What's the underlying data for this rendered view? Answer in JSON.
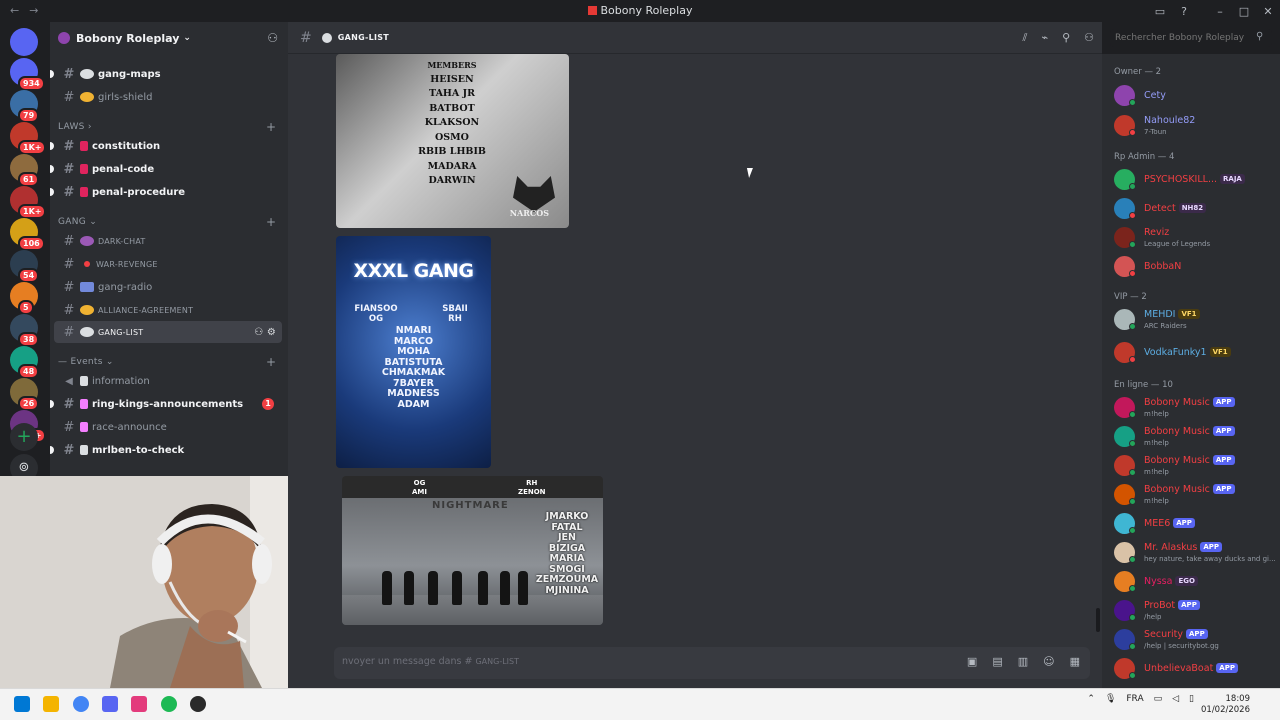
{
  "window": {
    "title": "Bobony Roleplay"
  },
  "servers": {
    "items": [
      {
        "badge": "934",
        "color": "#5865f2"
      },
      {
        "badge": "79",
        "color": "#3a6ea5"
      },
      {
        "badge": "1K+",
        "color": "#c0392b"
      },
      {
        "badge": "61",
        "color": "#8e6b3e"
      },
      {
        "badge": "1K+",
        "color": "#b03030"
      },
      {
        "badge": "106",
        "color": "#d4a017"
      },
      {
        "badge": "54",
        "color": "#2c3e50"
      },
      {
        "badge": "5",
        "color": "#e67e22"
      },
      {
        "badge": "38",
        "color": "#34495e"
      },
      {
        "badge": "48",
        "color": "#16a085"
      },
      {
        "badge": "26",
        "color": "#7f6a3a"
      },
      {
        "badge": "2K+",
        "color": "#6c3483"
      }
    ]
  },
  "guild": {
    "name": "Bobony Roleplay"
  },
  "sidebar": {
    "channels_top": [
      {
        "name": "gang-maps",
        "emoji_color": "#dbdee1",
        "unread": true
      },
      {
        "name": "girls-shield",
        "emoji_color": "#f0b232",
        "unread": false
      }
    ],
    "cat_laws": "LAWS",
    "laws": [
      {
        "name": "constitution"
      },
      {
        "name": "penal-code"
      },
      {
        "name": "penal-procedure"
      }
    ],
    "cat_gang": "GANG",
    "gang": [
      {
        "name": "DARK-CHAT"
      },
      {
        "name": "WAR-REVENGE"
      },
      {
        "name": "gang-radio"
      },
      {
        "name": "ALLIANCE-AGREEMENT"
      },
      {
        "name": "GANG-LIST"
      }
    ],
    "cat_events": "Events",
    "events": [
      {
        "name": "information"
      },
      {
        "name": "ring-kings-announcements",
        "badge": "1"
      },
      {
        "name": "race-announce"
      },
      {
        "name": "mrlben-to-check"
      }
    ]
  },
  "channel": {
    "name": "GANG-LIST"
  },
  "search": {
    "placeholder": "Rechercher Bobony Roleplay"
  },
  "messages": {
    "img1": {
      "header": "MEMBERS",
      "names": [
        "HEISEN",
        "TAHA JR",
        "BATBOT",
        "KLAKSON",
        "OSMO",
        "RBIB LHBIB",
        "MADARA",
        "DARWIN"
      ],
      "brand": "NARCOS"
    },
    "img2": {
      "title": "XXXL GANG",
      "og_name": "FIANSOO",
      "og_tag": "OG",
      "rh_name": "SBAII",
      "rh_tag": "RH",
      "names": [
        "NMARI",
        "MARCO",
        "MOHA",
        "BATISTUTA",
        "CHMAKMAK",
        "7BAYER",
        "MADNESS",
        "ADAM"
      ]
    },
    "img3": {
      "og_tag": "OG",
      "og_name": "AMI",
      "rh_tag": "RH",
      "rh_name": "ZENON",
      "band": "NIGHTMARE",
      "names": [
        "JMARKO",
        "FATAL",
        "JEN",
        "BIZIGA",
        "MARIA",
        "SMOGI",
        "ZEMZOUMA",
        "MJININA"
      ]
    }
  },
  "composer": {
    "placeholder": "nvoyer un message dans #",
    "channel": "GANG-LIST"
  },
  "members": {
    "groups": [
      {
        "label": "Owner — 2",
        "items": [
          {
            "name": "Cety",
            "color": "#949cf7",
            "av": "#8e44ad",
            "status": "online"
          },
          {
            "name": "Nahoule82",
            "color": "#949cf7",
            "av": "#c0392b",
            "status": "dnd",
            "sub": "7-Toun"
          }
        ]
      },
      {
        "label": "Rp Admin — 4",
        "items": [
          {
            "name": "PSYCHOSKILL...",
            "color": "#f23f43",
            "av": "#27ae60",
            "status": "online",
            "tag": "RAJA"
          },
          {
            "name": "Detect",
            "color": "#f23f43",
            "av": "#2980b9",
            "status": "dnd",
            "tag": "NH82"
          },
          {
            "name": "Reviz",
            "color": "#f23f43",
            "av": "#7b241c",
            "status": "online",
            "sub": "League of Legends"
          },
          {
            "name": "BobbaN",
            "color": "#f23f43",
            "av": "#d35454",
            "status": "dnd"
          }
        ]
      },
      {
        "label": "VIP — 2",
        "items": [
          {
            "name": "MEHDI",
            "color": "#5dade2",
            "av": "#aab7b8",
            "status": "online",
            "tag": "VF1",
            "sub": "ARC Raiders"
          },
          {
            "name": "VodkaFunky1",
            "color": "#5dade2",
            "av": "#c0392b",
            "status": "dnd",
            "tag": "VF1"
          }
        ]
      },
      {
        "label": "En ligne — 10",
        "items": [
          {
            "name": "Bobony Music",
            "color": "#f23f43",
            "av": "#c2185b",
            "status": "online",
            "tag": "APP",
            "sub": "m!help"
          },
          {
            "name": "Bobony Music",
            "color": "#f23f43",
            "av": "#16a085",
            "status": "online",
            "tag": "APP",
            "sub": "m!help"
          },
          {
            "name": "Bobony Music",
            "color": "#f23f43",
            "av": "#c0392b",
            "status": "online",
            "tag": "APP",
            "sub": "m!help"
          },
          {
            "name": "Bobony Music",
            "color": "#f23f43",
            "av": "#d35400",
            "status": "online",
            "tag": "APP",
            "sub": "m!help"
          },
          {
            "name": "MEE6",
            "color": "#f23f43",
            "av": "#3fb6d3",
            "status": "online",
            "tag": "APP"
          },
          {
            "name": "Mr. Alaskus",
            "color": "#f23f43",
            "av": "#d9c2a7",
            "status": "online",
            "tag": "APP",
            "sub": "hey nature, take away ducks and gi..."
          },
          {
            "name": "Nyssa",
            "color": "#e91e63",
            "av": "#e67e22",
            "status": "online",
            "tag": "EGO"
          },
          {
            "name": "ProBot",
            "color": "#f23f43",
            "av": "#4a148c",
            "status": "online",
            "tag": "APP",
            "sub": "/help"
          },
          {
            "name": "Security",
            "color": "#f23f43",
            "av": "#2c3e9e",
            "status": "online",
            "tag": "APP",
            "sub": "/help | securitybot.gg"
          },
          {
            "name": "UnbelievaBoat",
            "color": "#f23f43",
            "av": "#c0392b",
            "status": "online",
            "tag": "APP"
          }
        ]
      }
    ]
  },
  "taskbar": {
    "lang": "FRA",
    "time": "18:09",
    "date": "01/02/2026"
  }
}
